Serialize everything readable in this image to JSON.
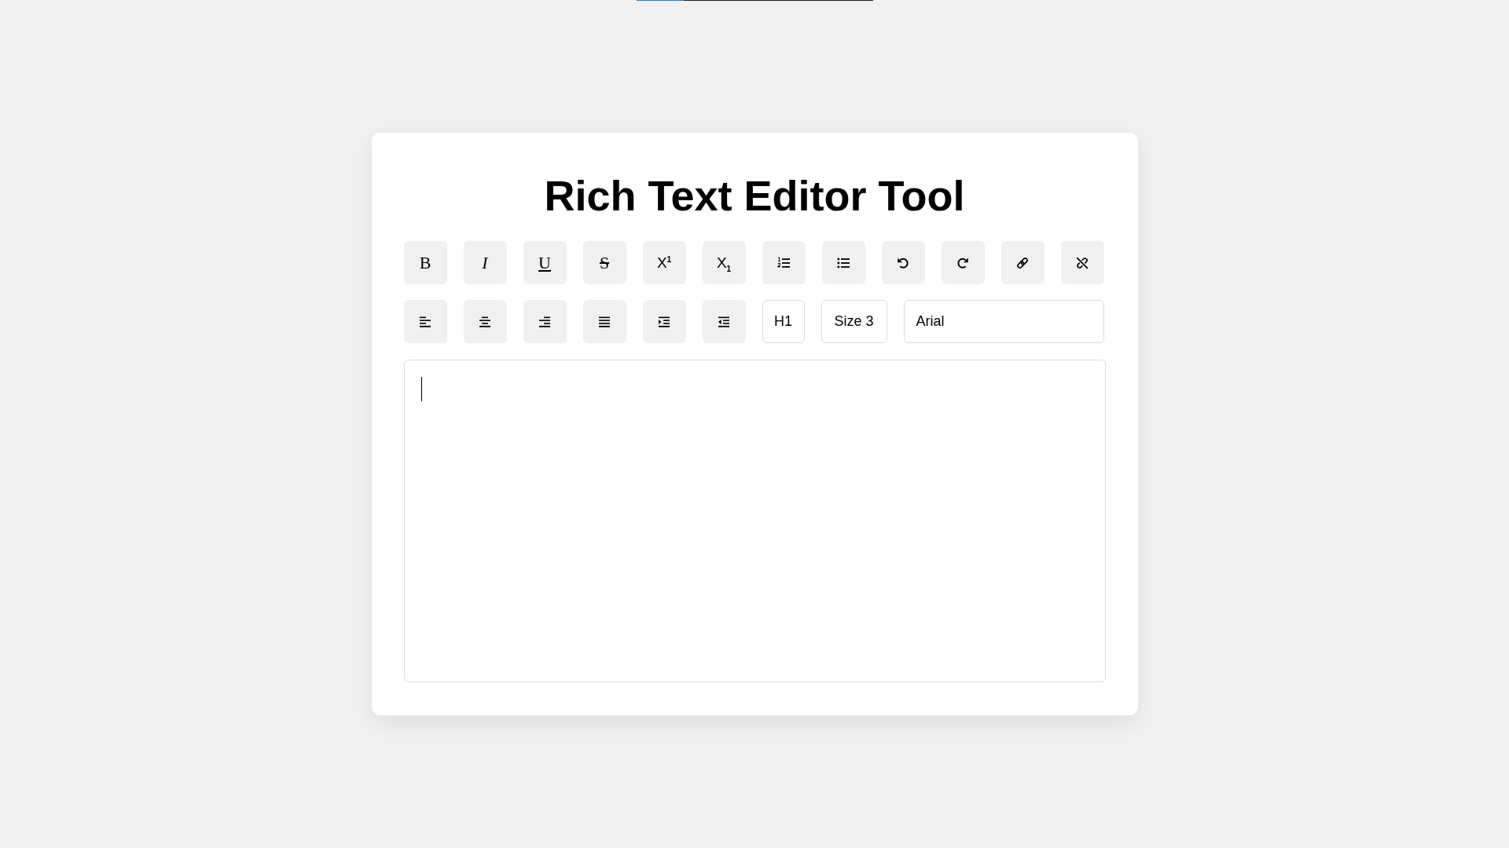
{
  "top_progress": {
    "level": 0.2
  },
  "title": "Rich Text Editor Tool",
  "toolbar_rows": [
    [
      {
        "kind": "bold",
        "label": "B"
      },
      {
        "kind": "italic",
        "label": "I"
      },
      {
        "kind": "underline",
        "label": "U"
      },
      {
        "kind": "strikethrough",
        "label": "S"
      },
      {
        "kind": "superscript",
        "label": "X$^{1}$"
      },
      {
        "kind": "subscript",
        "label": "X$_{1}$"
      },
      {
        "kind": "ordered-list"
      },
      {
        "kind": "unordered-list"
      },
      {
        "kind": "undo"
      },
      {
        "kind": "redo"
      },
      {
        "kind": "link"
      },
      {
        "kind": "unlink"
      }
    ],
    [
      {
        "kind": "align-left"
      },
      {
        "kind": "align-center"
      },
      {
        "kind": "align-right"
      },
      {
        "kind": "justify"
      },
      {
        "kind": "indent"
      },
      {
        "kind": "outdent"
      },
      {
        "kind": "heading",
        "value": "H1"
      },
      {
        "kind": "size",
        "value": "Size 3"
      },
      {
        "kind": "font",
        "value": "Arial"
      }
    ]
  ],
  "editor": {
    "focused": true
  }
}
